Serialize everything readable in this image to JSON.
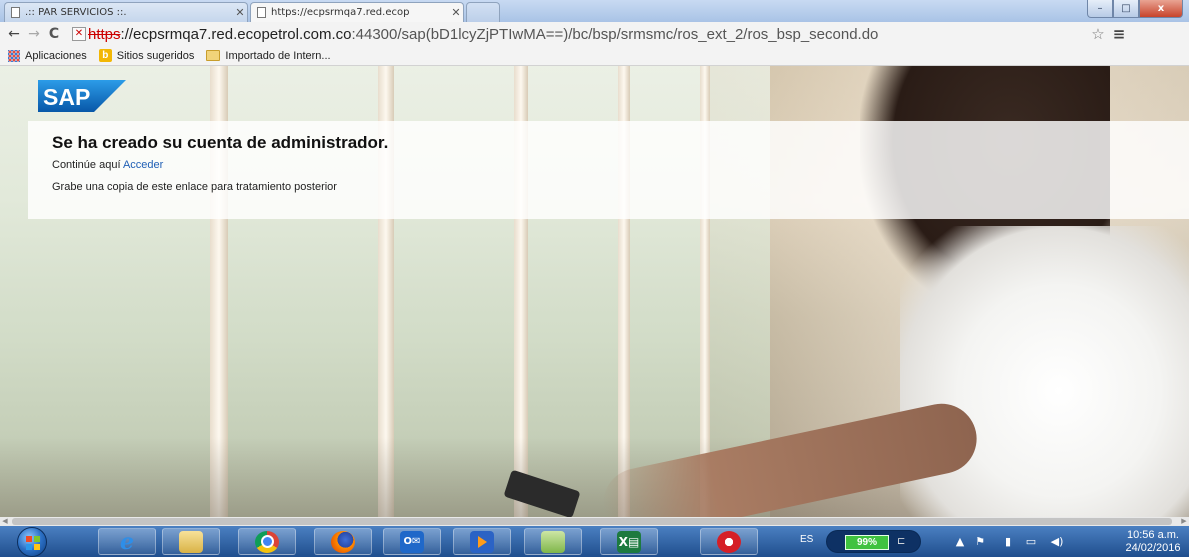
{
  "browser": {
    "tabs": [
      {
        "label": ".:: PAR SERVICIOS ::.",
        "active": false
      },
      {
        "label": "https://ecpsrmqa7.red.ecop",
        "active": true
      }
    ],
    "window_controls": {
      "minimize": "–",
      "maximize": "□",
      "close": "x"
    },
    "address": {
      "protocol": "https",
      "rest_prefix": "://",
      "host": "ecpsrmqa7.red.ecopetrol.com.co",
      "path": ":44300/sap(bD1lcyZjPTIwMA==)/bc/bsp/srmsmc/ros_ext_2/ros_bsp_second.do"
    },
    "bookmarks": [
      {
        "label": "Aplicaciones",
        "icon": "apps-icon"
      },
      {
        "label": "Sitios sugeridos",
        "icon": "bing-icon"
      },
      {
        "label": "Importado de Intern...",
        "icon": "folder-icon"
      }
    ]
  },
  "page": {
    "logo": "SAP",
    "title": "Se ha creado su cuenta de administrador.",
    "continue_prefix": "Continúe aquí",
    "continue_link": "Acceder",
    "save_note": "Grabe una copia de este enlace para tratamiento posterior"
  },
  "taskbar": {
    "apps": [
      "internet-explorer-icon",
      "file-explorer-icon",
      "chrome-icon",
      "firefox-icon",
      "outlook-icon",
      "media-player-icon",
      "folder-app-icon",
      "excel-icon",
      "sap-gui-icon"
    ],
    "language": "ES",
    "battery": "99%",
    "time": "10:56 a.m.",
    "date": "24/02/2016"
  },
  "colors": {
    "link": "#1f5fb5",
    "sap_blue": "#0a6ed1",
    "taskbar": "#1f4e8d",
    "battery_green": "#3fc23f"
  }
}
